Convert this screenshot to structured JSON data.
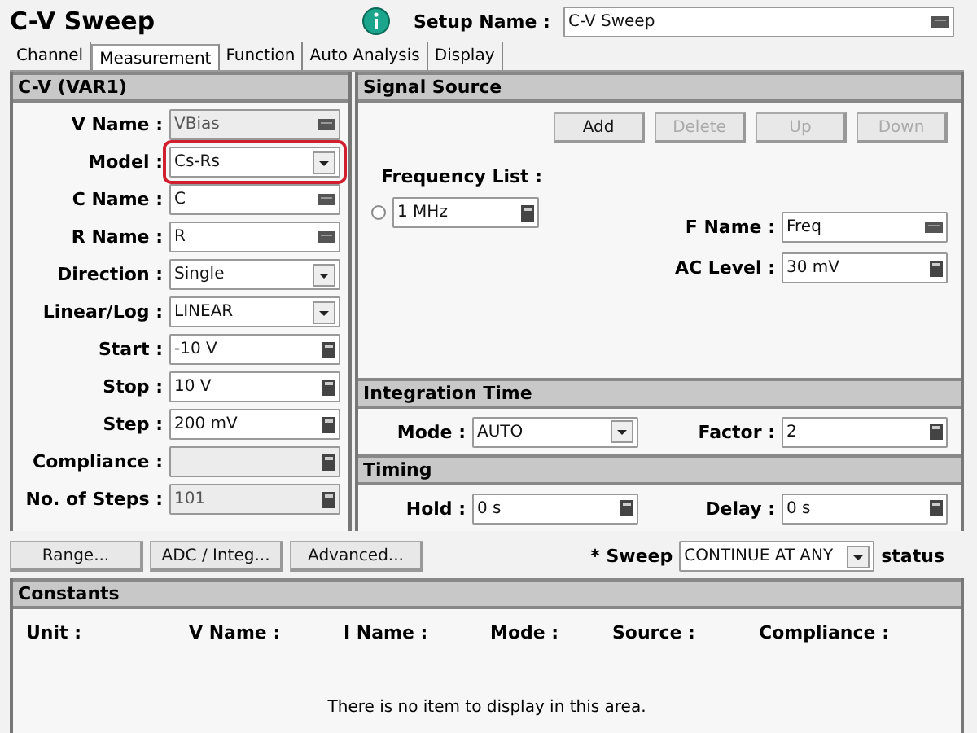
{
  "title": "C-V Sweep",
  "setup": {
    "label": "Setup Name :",
    "value": "C-V Sweep"
  },
  "tabs": [
    {
      "label": "Channel",
      "selected": false
    },
    {
      "label": "Measurement",
      "selected": true
    },
    {
      "label": "Function",
      "selected": false
    },
    {
      "label": "Auto Analysis",
      "selected": false
    },
    {
      "label": "Display",
      "selected": false
    }
  ],
  "var1": {
    "title": "C-V (VAR1)",
    "fields": [
      {
        "label": "V Name :",
        "value": "VBias",
        "kind": "text",
        "disabled": true,
        "highlighted": false
      },
      {
        "label": "Model :",
        "value": "Cs-Rs",
        "kind": "select",
        "disabled": false,
        "highlighted": true
      },
      {
        "label": "C Name :",
        "value": "C",
        "kind": "text",
        "disabled": false,
        "highlighted": false
      },
      {
        "label": "R Name :",
        "value": "R",
        "kind": "text",
        "disabled": false,
        "highlighted": false
      },
      {
        "label": "Direction :",
        "value": "Single",
        "kind": "select",
        "disabled": false,
        "highlighted": false
      },
      {
        "label": "Linear/Log :",
        "value": "LINEAR",
        "kind": "select",
        "disabled": false,
        "highlighted": false
      },
      {
        "label": "Start :",
        "value": "-10 V",
        "kind": "number",
        "disabled": false,
        "highlighted": false
      },
      {
        "label": "Stop :",
        "value": "10 V",
        "kind": "number",
        "disabled": false,
        "highlighted": false
      },
      {
        "label": "Step :",
        "value": "200 mV",
        "kind": "number",
        "disabled": false,
        "highlighted": false
      },
      {
        "label": "Compliance :",
        "kind": "number",
        "disabled": true,
        "highlighted": false
      },
      {
        "label": "No. of Steps :",
        "value": "101",
        "kind": "number",
        "disabled": true,
        "highlighted": false
      }
    ]
  },
  "signal_source": {
    "title": "Signal Source",
    "buttons": [
      {
        "label": "Add",
        "disabled": false
      },
      {
        "label": "Delete",
        "disabled": true
      },
      {
        "label": "Up",
        "disabled": true
      },
      {
        "label": "Down",
        "disabled": true
      }
    ],
    "frequency_list_label": "Frequency List :",
    "frequencies": [
      {
        "value": "1 MHz",
        "selected": false
      }
    ],
    "fields": [
      {
        "label": "F Name :",
        "value": "Freq",
        "kind": "text"
      },
      {
        "label": "AC Level :",
        "value": "30 mV",
        "kind": "number"
      }
    ]
  },
  "integration_time": {
    "title": "Integration Time",
    "fields": [
      {
        "label": "Mode :",
        "value": "AUTO",
        "kind": "select"
      },
      {
        "label": "Factor :",
        "value": "2",
        "kind": "number"
      }
    ]
  },
  "timing": {
    "title": "Timing",
    "fields": [
      {
        "label": "Hold :",
        "value": "0 s",
        "kind": "number"
      },
      {
        "label": "Delay :",
        "value": "0 s",
        "kind": "number"
      }
    ]
  },
  "buttons": [
    "Range...",
    "ADC / Integ...",
    "Advanced..."
  ],
  "sweep": {
    "label": "* Sweep",
    "value": "CONTINUE AT ANY",
    "suffix": "status"
  },
  "constants": {
    "title": "Constants",
    "columns": [
      "Unit :",
      "V Name :",
      "I Name :",
      "Mode :",
      "Source :",
      "Compliance :"
    ],
    "empty_message": "There is no item to display in this area."
  }
}
